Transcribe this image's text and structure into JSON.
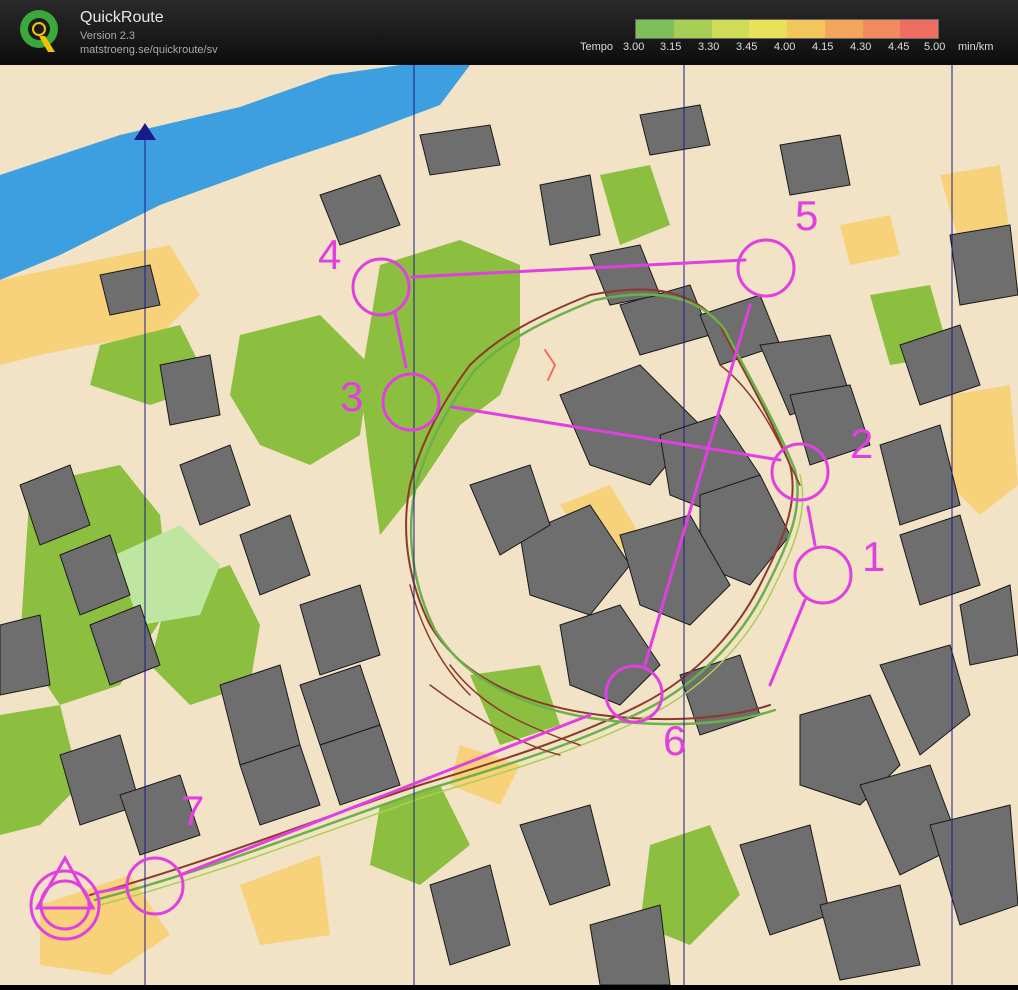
{
  "app": {
    "name": "QuickRoute",
    "version": "Version 2.3",
    "url": "matstroeng.se/quickroute/sv",
    "logo_letter": "Q"
  },
  "legend": {
    "label": "Tempo",
    "ticks": [
      "3.00",
      "3.15",
      "3.30",
      "3.45",
      "4.00",
      "4.15",
      "4.30",
      "4.45",
      "5.00"
    ],
    "unit": "min/km",
    "colors": [
      "#7fbf5a",
      "#a7cf55",
      "#cfdc57",
      "#e9e15a",
      "#f2c65a",
      "#f4a55c",
      "#f28a60",
      "#ee6e62"
    ]
  },
  "course": {
    "color": "#e040e0",
    "controls": [
      {
        "number": "1"
      },
      {
        "number": "2"
      },
      {
        "number": "3"
      },
      {
        "number": "4"
      },
      {
        "number": "5"
      },
      {
        "number": "6"
      },
      {
        "number": "7"
      }
    ]
  },
  "map_colors": {
    "water": "#3d9fe0",
    "building": "#6e6e6e",
    "open": "#f7d27a",
    "green": "#8cbf3f",
    "paved": "#f3e3c6",
    "magnetic_north_lines": "#1a1a8a"
  }
}
